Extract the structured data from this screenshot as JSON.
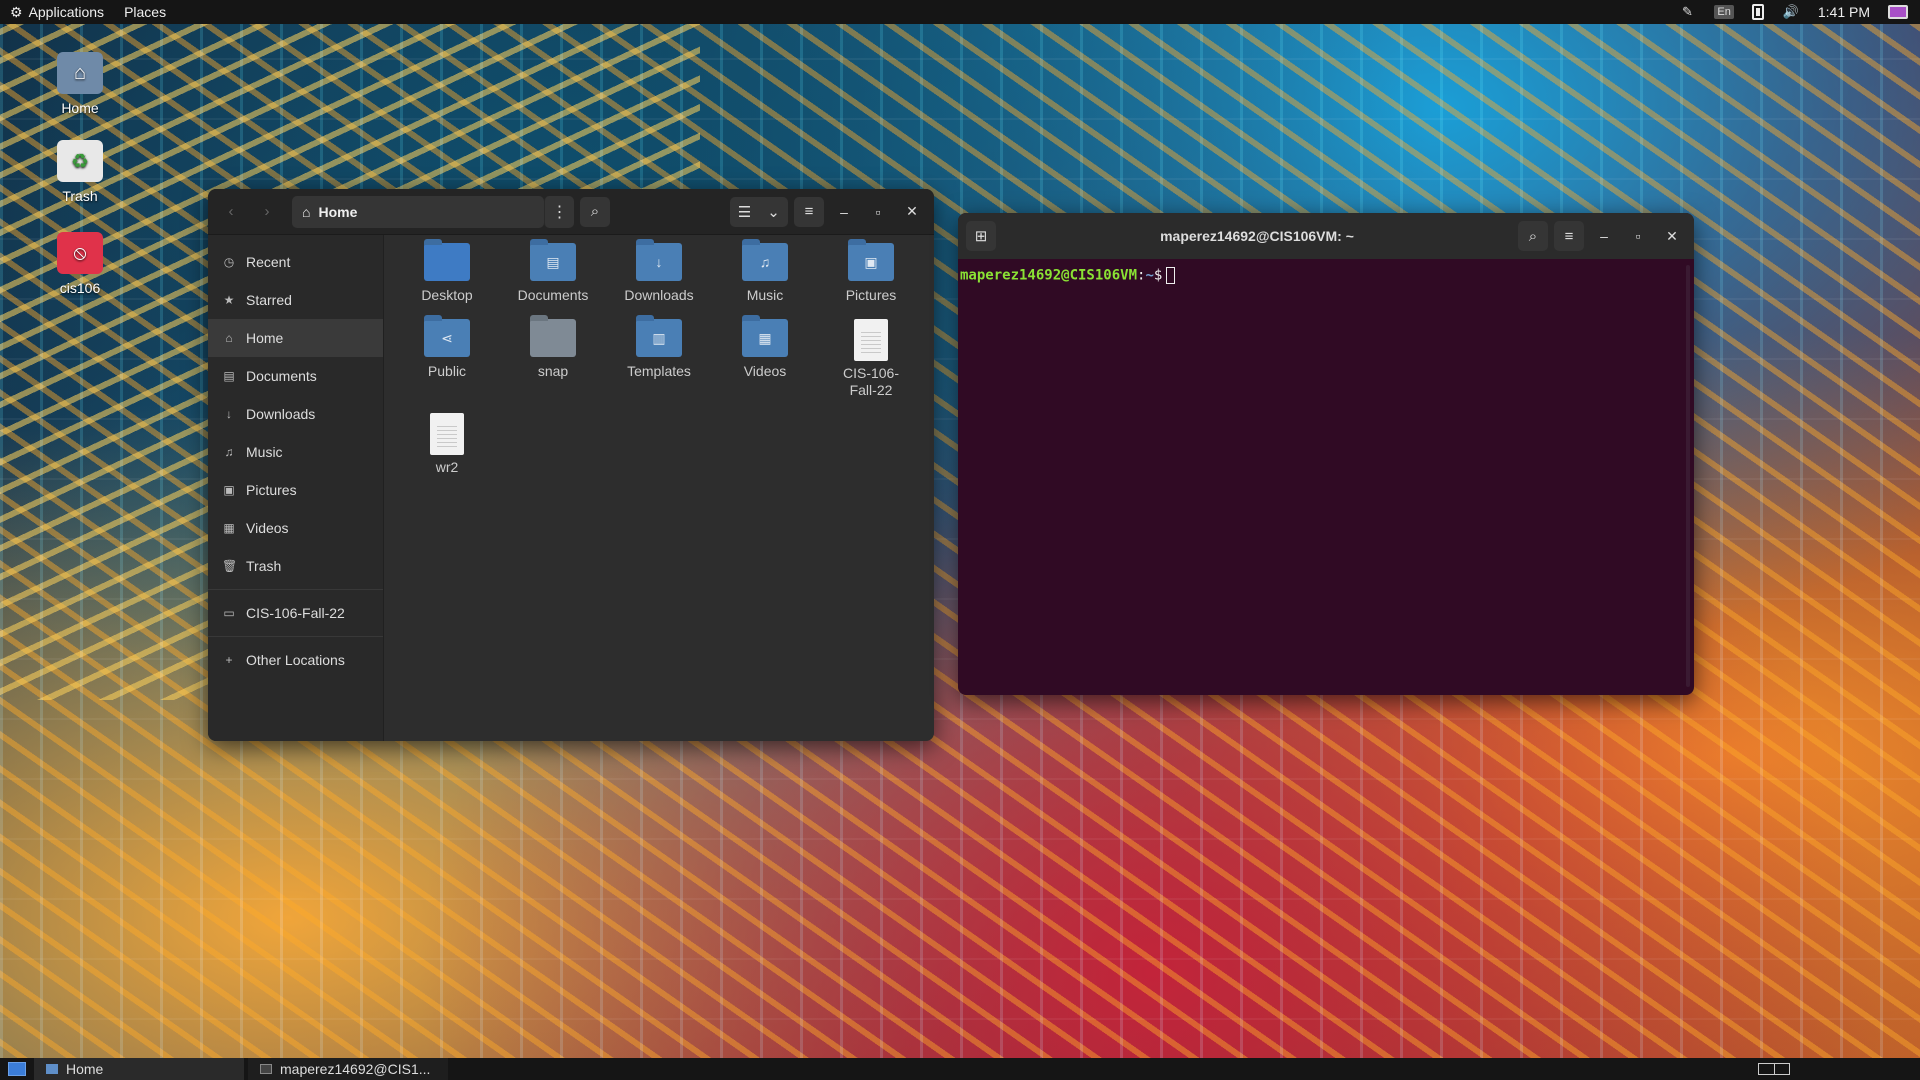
{
  "top_panel": {
    "applications_label": "Applications",
    "places_label": "Places",
    "language": "En",
    "clock": "1:41 PM"
  },
  "desktop_icons": [
    {
      "label": "Home",
      "icon": "home-folder-icon"
    },
    {
      "label": "Trash",
      "icon": "trash-icon"
    },
    {
      "label": "cis106",
      "icon": "blocked-folder-icon"
    }
  ],
  "files_window": {
    "path": "Home",
    "sidebar": {
      "items": [
        {
          "label": "Recent",
          "icon": "clock-icon"
        },
        {
          "label": "Starred",
          "icon": "star-icon"
        },
        {
          "label": "Home",
          "icon": "home-icon",
          "active": true
        },
        {
          "label": "Documents",
          "icon": "document-icon"
        },
        {
          "label": "Downloads",
          "icon": "download-icon"
        },
        {
          "label": "Music",
          "icon": "music-icon"
        },
        {
          "label": "Pictures",
          "icon": "picture-icon"
        },
        {
          "label": "Videos",
          "icon": "video-icon"
        },
        {
          "label": "Trash",
          "icon": "trash-icon"
        }
      ],
      "bookmark": {
        "label": "CIS-106-Fall-22",
        "icon": "folder-icon"
      },
      "other": {
        "label": "Other Locations",
        "icon": "plus-icon"
      }
    },
    "items": [
      {
        "label": "Desktop",
        "kind": "folder"
      },
      {
        "label": "Documents",
        "kind": "folder"
      },
      {
        "label": "Downloads",
        "kind": "folder"
      },
      {
        "label": "Music",
        "kind": "folder"
      },
      {
        "label": "Pictures",
        "kind": "folder"
      },
      {
        "label": "Public",
        "kind": "folder"
      },
      {
        "label": "snap",
        "kind": "folder"
      },
      {
        "label": "Templates",
        "kind": "folder"
      },
      {
        "label": "Videos",
        "kind": "folder"
      },
      {
        "label": "CIS-106-\nFall-22",
        "kind": "file"
      },
      {
        "label": "wr2",
        "kind": "file"
      }
    ]
  },
  "terminal_window": {
    "title": "maperez14692@CIS106VM: ~",
    "prompt_user": "maperez14692@CIS106VM",
    "prompt_colon": ":",
    "prompt_path": "~",
    "prompt_symbol": "$"
  },
  "bottom_panel": {
    "tasks": [
      {
        "label": "Home"
      },
      {
        "label": "maperez14692@CIS1..."
      }
    ]
  },
  "colors": {
    "terminal_bg": "#300a24",
    "folder_blue": "#4a7fb5",
    "prompt_green": "#8ae234",
    "prompt_blue": "#729fcf"
  }
}
